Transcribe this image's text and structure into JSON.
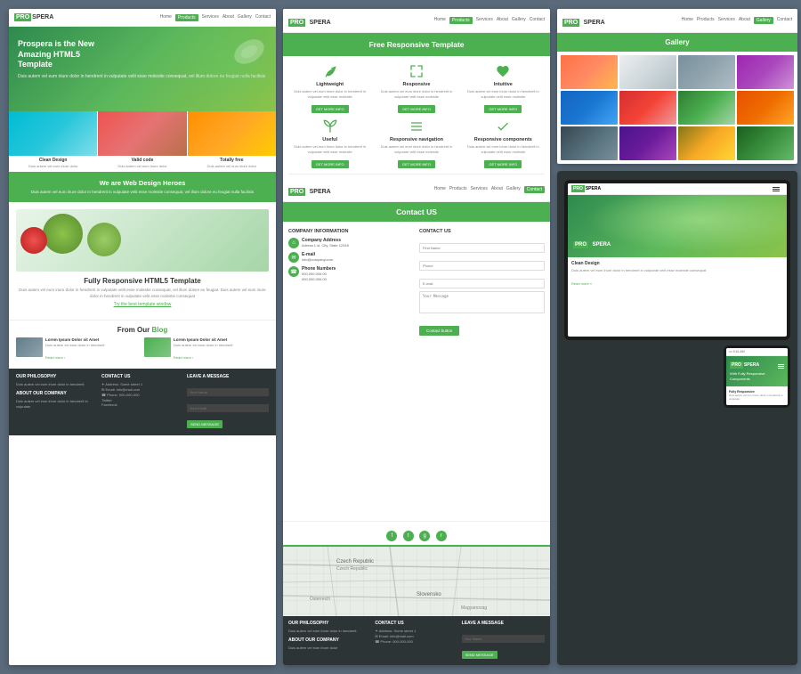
{
  "col1": {
    "nav": {
      "logo_pro": "PRO",
      "logo_text": "SPERA",
      "links": [
        "Home",
        "Products",
        "Services",
        "About",
        "Gallery",
        "Contact"
      ]
    },
    "hero": {
      "line1": "Prospera is the New",
      "line2": "Amazing HTML5",
      "line3": "Template",
      "desc": "Duis autem vel eum iriure dolor in hendrerit in vulputate velit esse molestie consequat, vel illum dolore eu feugiat nulla facilisis"
    },
    "thumbs": [
      {
        "label": "Clean Design",
        "class": "t1"
      },
      {
        "label": "Valid code",
        "class": "t2"
      },
      {
        "label": "Totally free",
        "class": "t3"
      }
    ],
    "green_band": {
      "title": "We are Web Design Heroes",
      "desc": "Duis autem vel eum iriure dolor in hendrerit in vulputate velit esse molestie consequat, vel illum dolore eu feugiat nulla facilisis"
    },
    "responsive": {
      "title_plain": "Fully Responsive",
      "title_green": "HTML5 Template",
      "desc": "Duis autem vel eum iriure dolor in hendrerit in vulputate velit esse molestie consequat, vel illum dolore eu feugiat. Duis autem vel eum iriure dolor in hendrerit in vulputate velit esse molestie consequat",
      "link": "Try the best template window"
    },
    "blog": {
      "title_plain": "From Our",
      "title_green": "Blog",
      "posts": [
        {
          "title": "Lorem Ipsum Dolor sit Amet",
          "class": "b1"
        },
        {
          "title": "Lorem Ipsum Dolor sit Amet",
          "class": "b2"
        }
      ]
    },
    "footer": {
      "sections": [
        {
          "title": "OUR PHILOSOPHY"
        },
        {
          "title": "CONTACT US"
        },
        {
          "title": "LEAVE A MESSAGE"
        }
      ]
    }
  },
  "col2": {
    "nav": {
      "logo_pro": "PRO",
      "logo_text": "SPERA",
      "links": [
        "Home",
        "Products",
        "Services",
        "About",
        "Gallery",
        "Contact"
      ]
    },
    "features": {
      "header": "Free Responsive Template",
      "items": [
        {
          "icon": "leaf",
          "name": "Lightweight",
          "desc": "Duis autem vel eum iriure dolor in hendrerit in vulputate velit esse molestie consequat"
        },
        {
          "icon": "arrows",
          "name": "Responsive",
          "desc": "Duis autem vel eum iriure dolor in hendrerit in vulputate velit esse molestie consequat"
        },
        {
          "icon": "heart",
          "name": "Intuitive",
          "desc": "Duis autem vel eum iriure dolor in hendrerit in vulputate velit esse molestie consequat"
        },
        {
          "icon": "sprout",
          "name": "Useful",
          "desc": "Duis autem vel eum iriure dolor in hendrerit in vulputate velit esse molestie consequat"
        },
        {
          "icon": "nav",
          "name": "Responsive navigation",
          "desc": "Duis autem vel eum iriure dolor in hendrerit in vulputate velit esse molestie consequat"
        },
        {
          "icon": "check",
          "name": "Responsive components",
          "desc": "Duis autem vel eum iriure dolor in hendrerit in vulputate velit esse molestie consequat"
        }
      ],
      "btn": "GET MORE INFO"
    },
    "contact": {
      "header": "Contact US",
      "company_info_title": "COMPANY INFORMATION",
      "contact_us_title": "CONTACT US",
      "address_label": "Company Address",
      "address": "Adresa 1 st.\nCity, State 12345",
      "email_label": "E-mail",
      "email": "info@company.com",
      "phone_label": "Phone Numbers",
      "phone1": "000.000.000.00",
      "phone2": "000.000.000.00",
      "form_fields": [
        "First Name",
        "Phone",
        "E-mail",
        "Your Message"
      ],
      "submit_btn": "Contact button"
    },
    "footer": {
      "sections": [
        {
          "title": "OUR PHILOSOPHY"
        },
        {
          "title": "CONTACT US"
        },
        {
          "title": "LEAVE A MESSAGE"
        }
      ]
    }
  },
  "col3": {
    "gallery": {
      "header": "Gallery",
      "nav": {
        "logo_pro": "PRO",
        "logo_text": "SPERA"
      },
      "thumbs": [
        "g1",
        "g2",
        "g3",
        "g4",
        "g5",
        "g6",
        "g7",
        "g8",
        "g9",
        "g10",
        "g11",
        "g12"
      ]
    },
    "tablet": {
      "brand_pro": "PRO",
      "brand_text": "SPERA",
      "desc": "Duis autem vel eum iriure dolor in hendrerit in vulputate velit esse molestie consequat",
      "link": "Read more »"
    },
    "phone": {
      "brand_pro": "PRO",
      "brand_text": "SPERA",
      "hero_text": "With Fully Responsive Components",
      "desc": "Duis autem vel eum iriure dolor in hendrerit in vulputate"
    }
  }
}
